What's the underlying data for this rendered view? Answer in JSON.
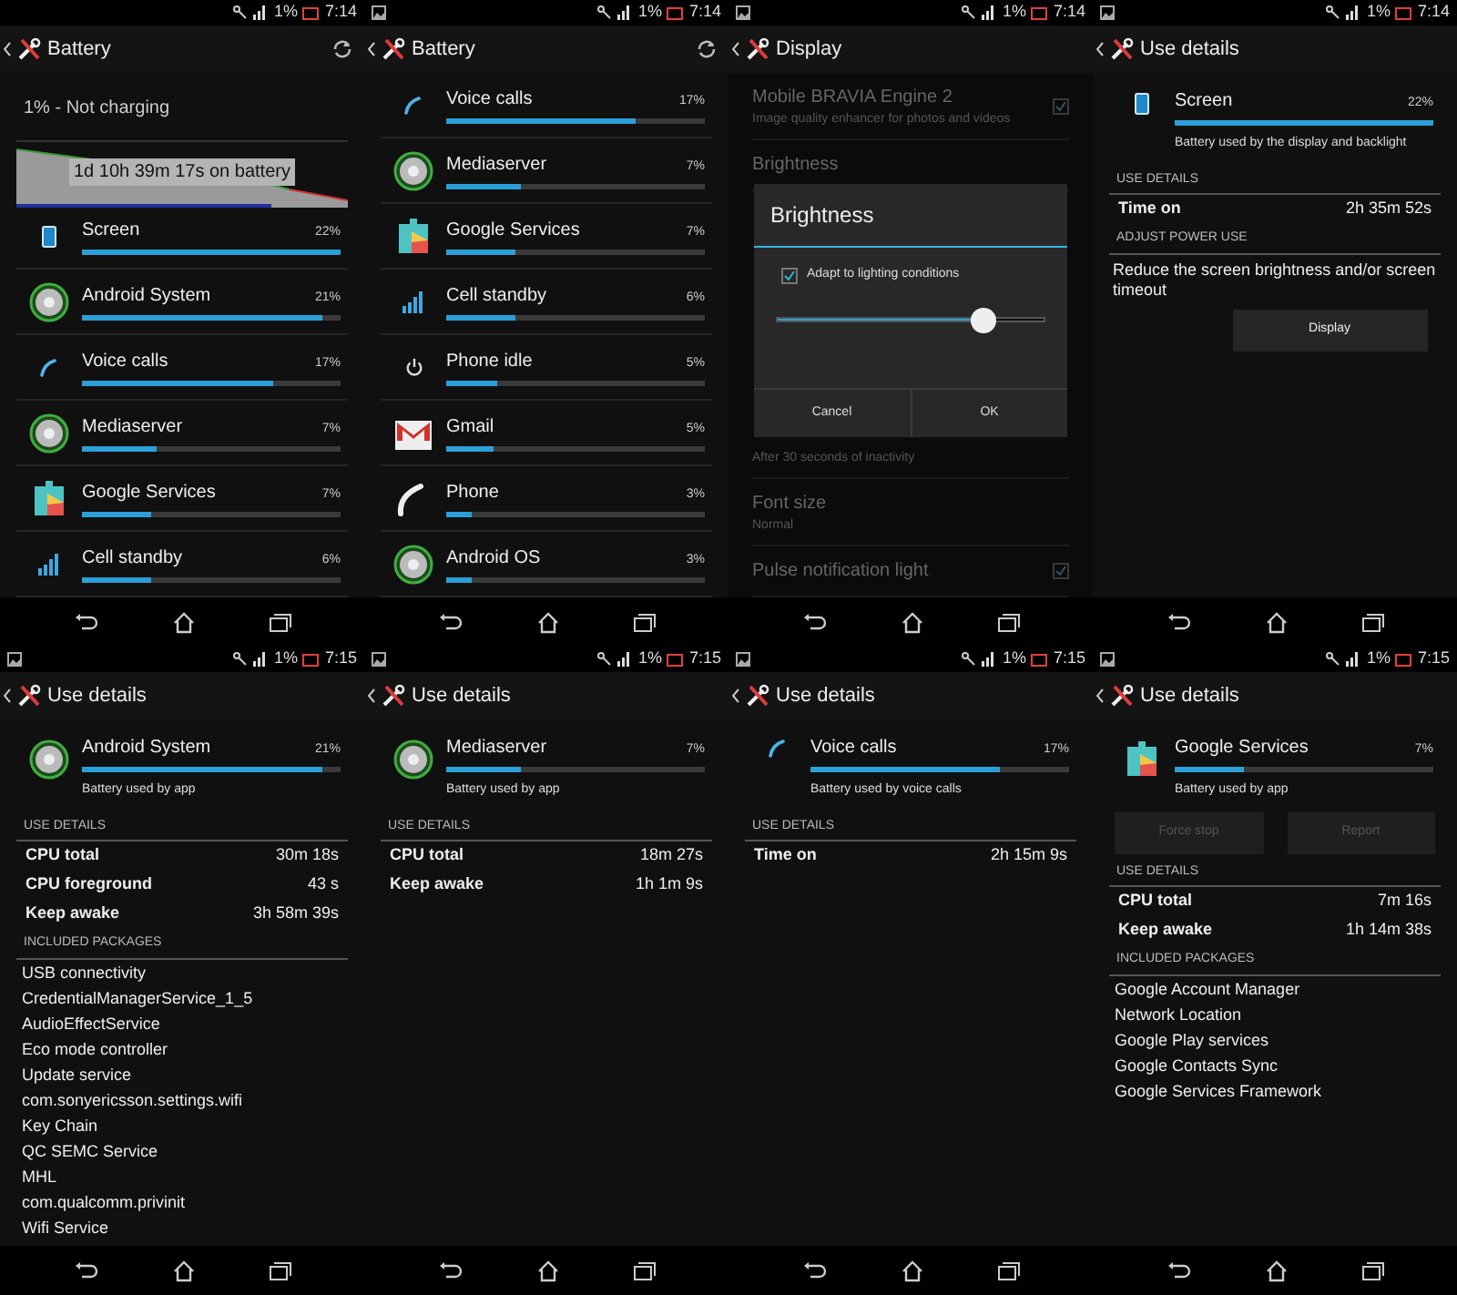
{
  "screens": [
    {
      "kind": "battery_list",
      "status": {
        "notification": false,
        "battery": "1%",
        "time": "7:14"
      },
      "title": "Battery",
      "summary": "1% - Not charging",
      "graph": {
        "caption": "1d 10h 39m 17s on battery"
      },
      "items": [
        {
          "name": "Screen",
          "percent": "22%",
          "level": 1.0,
          "kind": "screen"
        },
        {
          "name": "Android System",
          "percent": "21%",
          "level": 0.93,
          "kind": "android"
        },
        {
          "name": "Voice calls",
          "percent": "17%",
          "level": 0.74,
          "kind": "call"
        },
        {
          "name": "Mediaserver",
          "percent": "7%",
          "level": 0.29,
          "kind": "android"
        },
        {
          "name": "Google Services",
          "percent": "7%",
          "level": 0.27,
          "kind": "puzzle"
        },
        {
          "name": "Cell standby",
          "percent": "6%",
          "level": 0.27,
          "kind": "signal"
        }
      ]
    },
    {
      "kind": "battery_list",
      "status": {
        "notification": true,
        "battery": "1%",
        "time": "7:14"
      },
      "title": "Battery",
      "items": [
        {
          "name": "Voice calls",
          "percent": "17%",
          "level": 0.73,
          "kind": "call"
        },
        {
          "name": "Mediaserver",
          "percent": "7%",
          "level": 0.29,
          "kind": "android"
        },
        {
          "name": "Google Services",
          "percent": "7%",
          "level": 0.27,
          "kind": "puzzle"
        },
        {
          "name": "Cell standby",
          "percent": "6%",
          "level": 0.27,
          "kind": "signal"
        },
        {
          "name": "Phone idle",
          "percent": "5%",
          "level": 0.2,
          "kind": "power"
        },
        {
          "name": "Gmail",
          "percent": "5%",
          "level": 0.18,
          "kind": "mail"
        },
        {
          "name": "Phone",
          "percent": "3%",
          "level": 0.1,
          "kind": "handset"
        },
        {
          "name": "Android OS",
          "percent": "3%",
          "level": 0.1,
          "kind": "android"
        }
      ]
    },
    {
      "kind": "display_settings",
      "status": {
        "notification": true,
        "battery": "1%",
        "time": "7:14"
      },
      "title": "Display",
      "settings": [
        {
          "title": "Mobile BRAVIA Engine 2",
          "subtitle": "Image quality enhancer for photos and videos",
          "checked": true
        },
        {
          "title": "Brightness"
        },
        {
          "subtitle": "After 30 seconds of inactivity"
        },
        {
          "title": "Font size",
          "subtitle": "Normal"
        },
        {
          "title": "Pulse notification light",
          "checked": true
        }
      ],
      "dialog": {
        "title": "Brightness",
        "option": "Adapt to lighting conditions",
        "checked": true,
        "level": 0.77,
        "buttons": [
          "Cancel",
          "OK"
        ]
      }
    },
    {
      "kind": "use_details",
      "status": {
        "notification": true,
        "battery": "1%",
        "time": "7:14"
      },
      "title": "Use details",
      "header": {
        "name": "Screen",
        "percent": "22%",
        "level": 1.0,
        "kind": "screen",
        "caption": "Battery used by the display and backlight"
      },
      "sections": [
        {
          "kind": "stats",
          "heading": "USE DETAILS",
          "rows": [
            {
              "label": "Time on",
              "value": "2h 35m 52s"
            }
          ]
        },
        {
          "kind": "action",
          "heading": "ADJUST POWER USE",
          "text": "Reduce the screen brightness and/or screen timeout",
          "button": "Display"
        }
      ]
    },
    {
      "kind": "use_details",
      "status": {
        "notification": true,
        "battery": "1%",
        "time": "7:15"
      },
      "title": "Use details",
      "header": {
        "name": "Android System",
        "percent": "21%",
        "level": 0.93,
        "kind": "android",
        "caption": "Battery used by app"
      },
      "sections": [
        {
          "kind": "stats",
          "heading": "USE DETAILS",
          "rows": [
            {
              "label": "CPU total",
              "value": "30m 18s"
            },
            {
              "label": "CPU foreground",
              "value": "43 s"
            },
            {
              "label": "Keep awake",
              "value": "3h 58m 39s"
            }
          ]
        },
        {
          "kind": "packages",
          "heading": "INCLUDED PACKAGES",
          "packages": [
            "USB connectivity",
            "CredentialManagerService_1_5",
            "AudioEffectService",
            "Eco mode controller",
            "Update service",
            "com.sonyericsson.settings.wifi",
            "Key Chain",
            "QC SEMC Service",
            "MHL",
            "com.qualcomm.privinit",
            "Wifi Service"
          ]
        }
      ]
    },
    {
      "kind": "use_details",
      "status": {
        "notification": true,
        "battery": "1%",
        "time": "7:15"
      },
      "title": "Use details",
      "header": {
        "name": "Mediaserver",
        "percent": "7%",
        "level": 0.29,
        "kind": "android",
        "caption": "Battery used by app"
      },
      "sections": [
        {
          "kind": "stats",
          "heading": "USE DETAILS",
          "rows": [
            {
              "label": "CPU total",
              "value": "18m 27s"
            },
            {
              "label": "Keep awake",
              "value": "1h 1m 9s"
            }
          ]
        }
      ]
    },
    {
      "kind": "use_details",
      "status": {
        "notification": true,
        "battery": "1%",
        "time": "7:15"
      },
      "title": "Use details",
      "header": {
        "name": "Voice calls",
        "percent": "17%",
        "level": 0.73,
        "kind": "call",
        "caption": "Battery used by voice calls"
      },
      "sections": [
        {
          "kind": "stats",
          "heading": "USE DETAILS",
          "rows": [
            {
              "label": "Time on",
              "value": "2h 15m 9s"
            }
          ]
        }
      ]
    },
    {
      "kind": "use_details",
      "status": {
        "notification": true,
        "battery": "1%",
        "time": "7:15"
      },
      "title": "Use details",
      "header": {
        "name": "Google Services",
        "percent": "7%",
        "level": 0.27,
        "kind": "puzzle",
        "caption": "Battery used by app"
      },
      "buttons": [
        {
          "label": "Force stop",
          "disabled": true
        },
        {
          "label": "Report",
          "disabled": true
        }
      ],
      "sections": [
        {
          "kind": "stats",
          "heading": "USE DETAILS",
          "rows": [
            {
              "label": "CPU total",
              "value": "7m 16s"
            },
            {
              "label": "Keep awake",
              "value": "1h 14m 38s"
            }
          ]
        },
        {
          "kind": "packages",
          "heading": "INCLUDED PACKAGES",
          "packages": [
            "Google Account Manager",
            "Network Location",
            "Google Play services",
            "Google Contacts Sync",
            "Google Services Framework"
          ]
        }
      ]
    }
  ]
}
